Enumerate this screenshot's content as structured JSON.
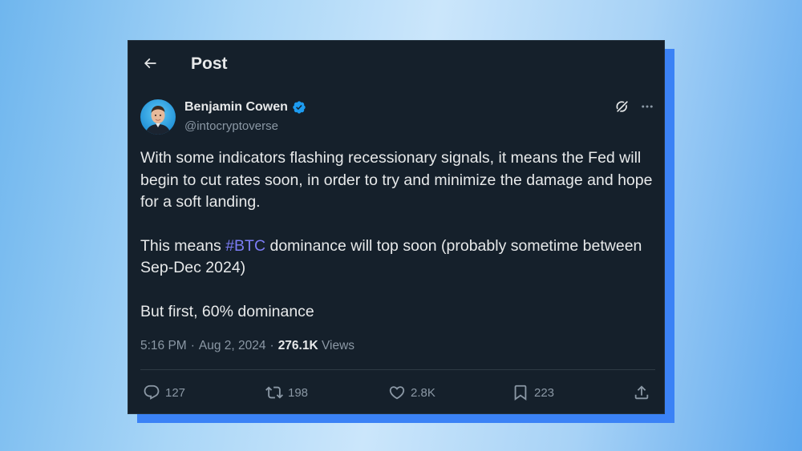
{
  "header": {
    "title": "Post"
  },
  "author": {
    "name": "Benjamin Cowen",
    "handle": "@intocryptoverse",
    "verified": true
  },
  "post": {
    "paragraph1": "With some indicators flashing recessionary signals, it means the Fed will begin to cut rates soon, in order to try and minimize the damage and hope for a soft landing.",
    "paragraph2_before": "This means ",
    "hashtag": "#BTC",
    "paragraph2_after": " dominance will top soon (probably sometime between Sep-Dec 2024)",
    "paragraph3": "But first, 60% dominance"
  },
  "meta": {
    "time": "5:16 PM",
    "date": "Aug 2, 2024",
    "separator": "·",
    "views_count": "276.1K",
    "views_label": "Views"
  },
  "actions": {
    "replies": "127",
    "reposts": "198",
    "likes": "2.8K",
    "bookmarks": "223"
  },
  "colors": {
    "background_card": "#15202b",
    "accent_shadow": "#3b82f6",
    "hashtag": "#7c7cf5",
    "verified_badge": "#1d9bf0"
  },
  "icons": [
    "back-arrow-icon",
    "verified-icon",
    "grok-icon",
    "more-icon",
    "reply-icon",
    "repost-icon",
    "like-icon",
    "bookmark-icon",
    "share-icon"
  ]
}
